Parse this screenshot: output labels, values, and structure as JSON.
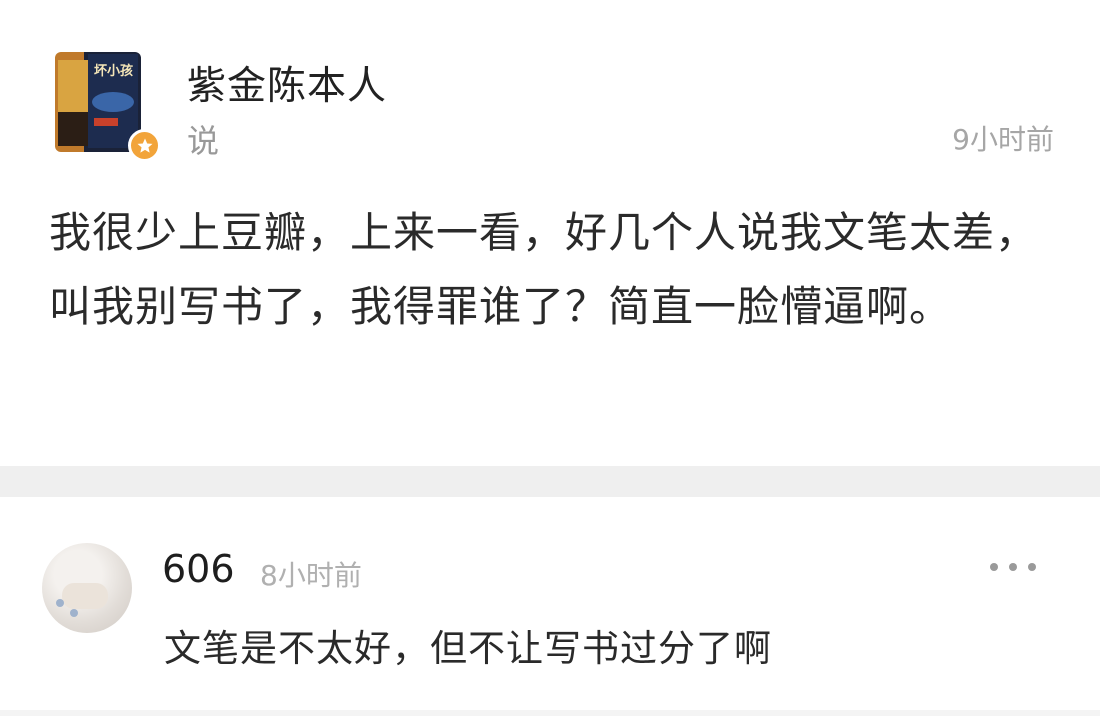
{
  "post": {
    "author": "紫金陈本人",
    "action": "说",
    "time": "9小时前",
    "text": "我很少上豆瓣，上来一看，好几个人说我文笔太差，叫我别写书了，我得罪谁了？简直一脸懵逼啊。",
    "book_cover_title": "坏小孩"
  },
  "comment": {
    "author": "606",
    "time": "8小时前",
    "text": "文笔是不太好，但不让写书过分了啊"
  },
  "colors": {
    "badge": "#f2a43a",
    "time_text": "#a6a6a6",
    "divider": "#efefef"
  },
  "icons": {
    "badge": "star-badge-icon",
    "more": "more-dots-icon"
  }
}
